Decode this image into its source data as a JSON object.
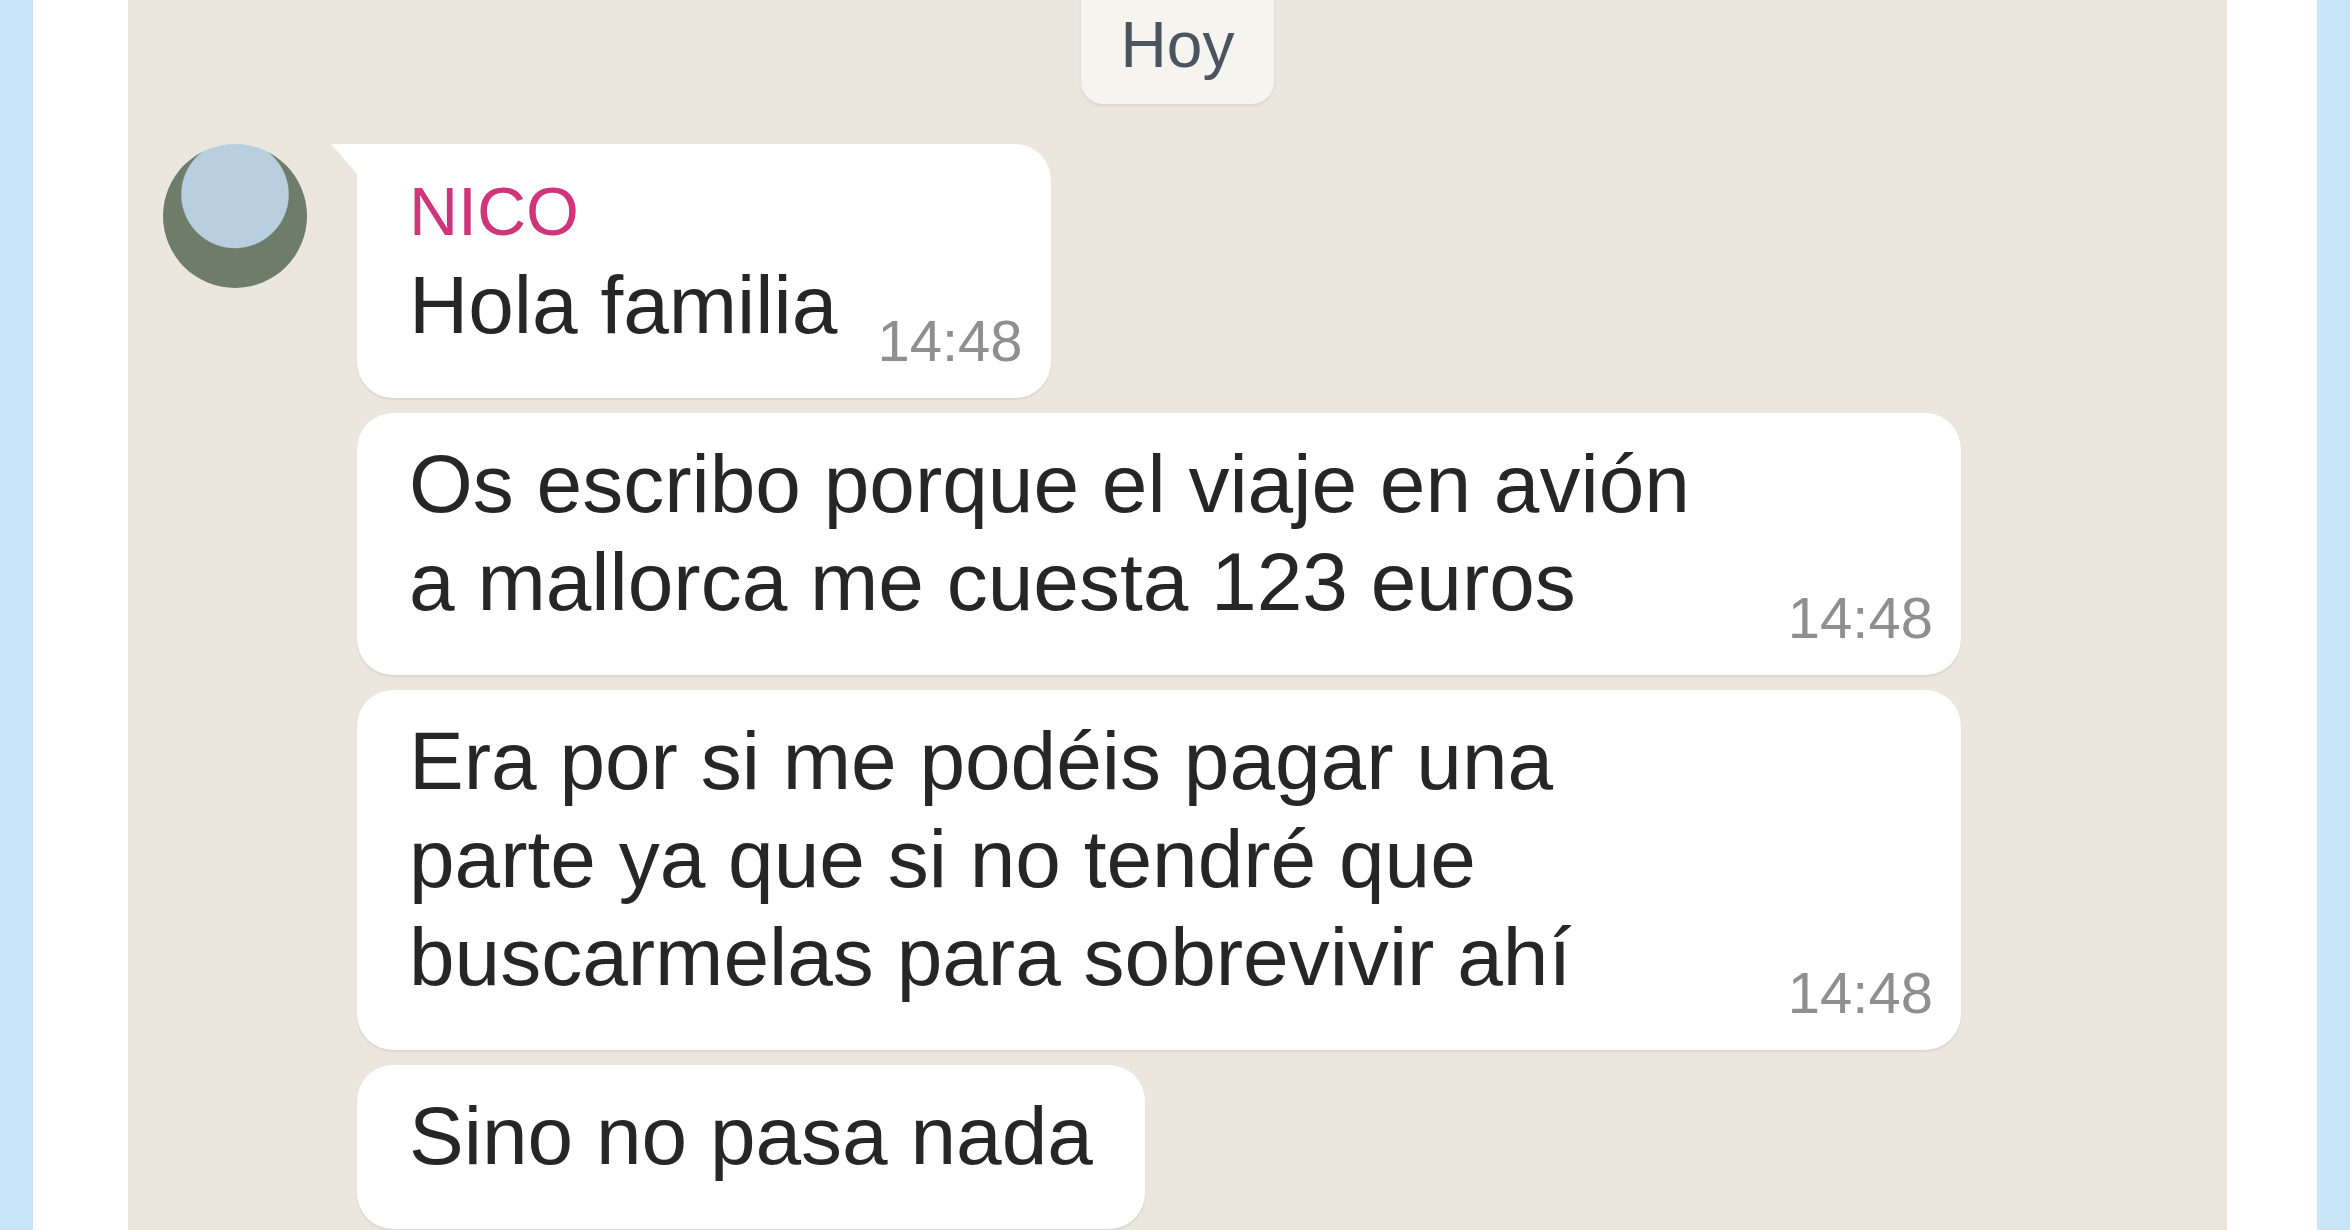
{
  "date_divider": "Hoy",
  "messages": [
    {
      "sender": "NICO",
      "text": "Hola familia",
      "time": "14:48"
    },
    {
      "text": "Os escribo porque el viaje en avión a mallorca me cuesta 123 euros",
      "time": "14:48"
    },
    {
      "text": "Era por si me podéis pagar una parte ya que si no tendré que buscarmelas para sobrevivir ahí",
      "time": "14:48"
    },
    {
      "text": "Sino no pasa nada"
    }
  ]
}
